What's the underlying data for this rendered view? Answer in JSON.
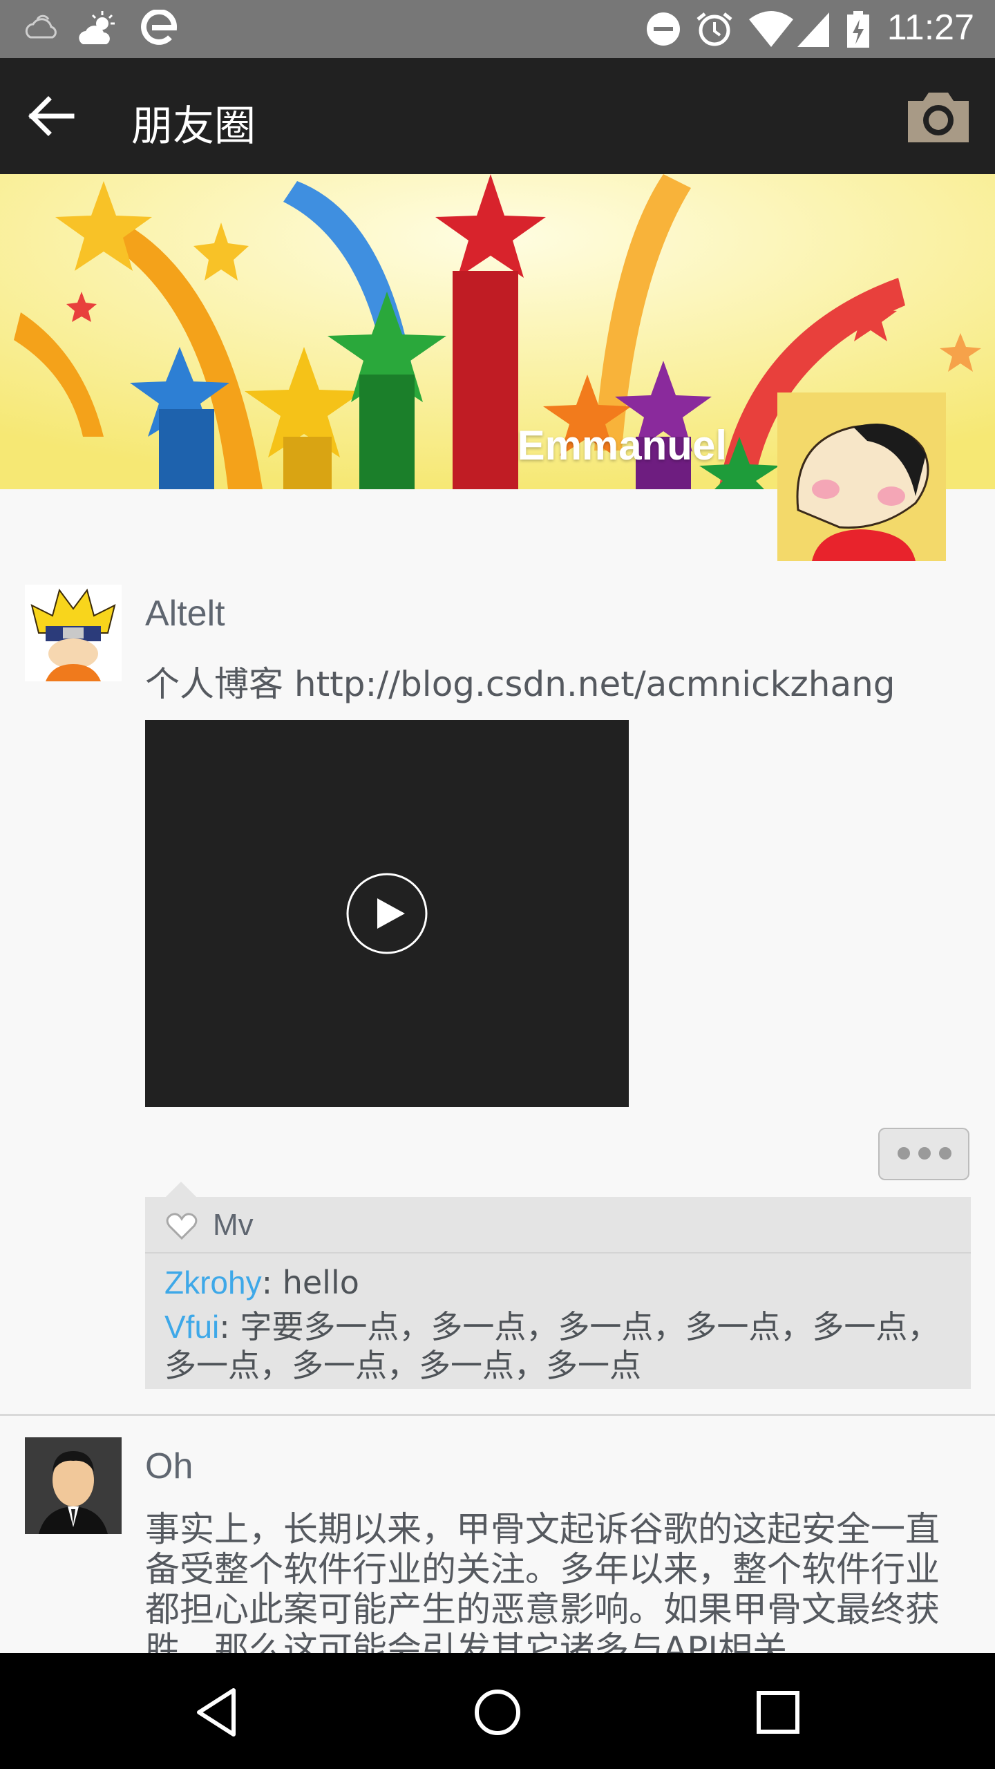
{
  "status_bar": {
    "time": "11:27",
    "icons": [
      "cloud-icon",
      "weather-sun-cloud-icon",
      "app-e-icon",
      "do-not-disturb-icon",
      "alarm-icon",
      "wifi-icon",
      "signal-icon",
      "battery-charging-icon"
    ],
    "background": "#777777"
  },
  "title_bar": {
    "title": "朋友圈",
    "back_icon": "arrow-back-icon",
    "camera_icon": "camera-icon",
    "background": "#212121"
  },
  "header": {
    "user_name": "Emmanuel",
    "avatar": "cartoon-avatar"
  },
  "posts": [
    {
      "user": "Altelt",
      "text": "个人博客 http://blog.csdn.net/acmnickzhang",
      "media": "video",
      "likes": "Mv",
      "comments": [
        {
          "name": "Zkrohy",
          "sep": ": ",
          "text": "hello"
        },
        {
          "name": "Vfui",
          "sep": ": ",
          "text": "字要多一点，多一点，多一点，多一点，多一点，多一点，多一点，多一点，多一点"
        }
      ]
    },
    {
      "user": "Oh",
      "text": "事实上，长期以来，甲骨文起诉谷歌的这起安全一直备受整个软件行业的关注。多年以来，整个软件行业都担心此案可能产生的恶意影响。如果甲骨文最终获胜，那么这可能会引发其它诸多与API相关"
    }
  ],
  "nav_bar": {
    "icons": [
      "nav-back-icon",
      "nav-home-icon",
      "nav-recents-icon"
    ]
  },
  "colors": {
    "comment_name": "#3ea8e8",
    "comment_bg": "#e4e4e4",
    "page_bg": "#f8f8f8"
  }
}
